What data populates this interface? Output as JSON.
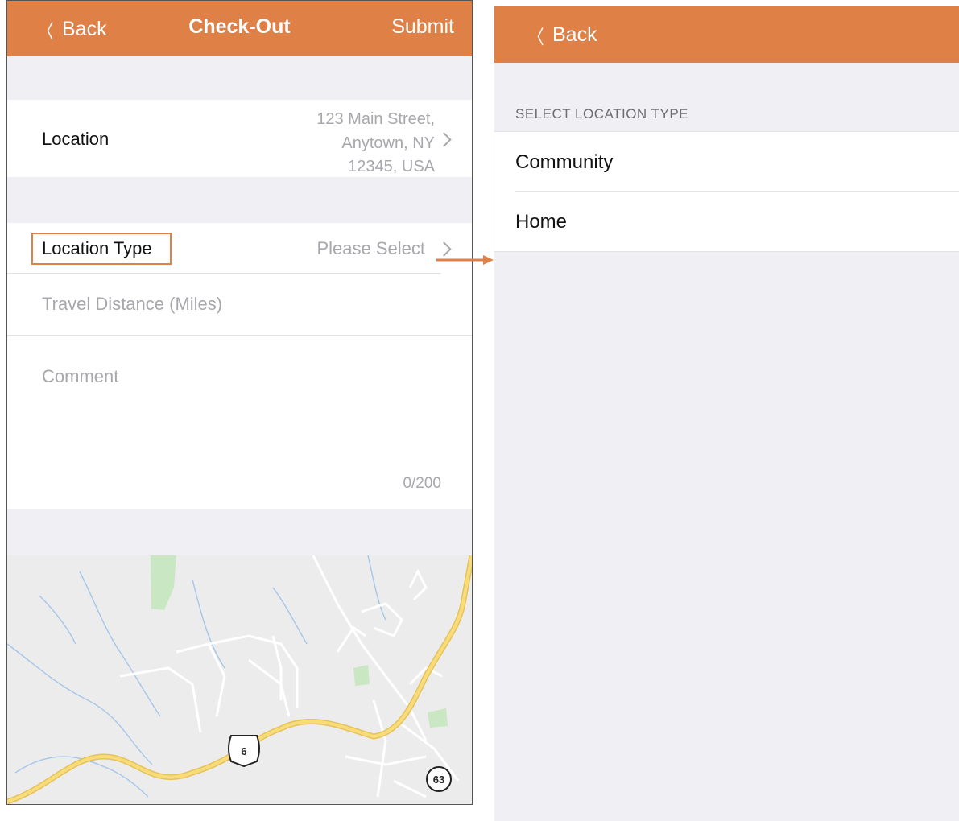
{
  "checkout": {
    "back_label": "Back",
    "title": "Check-Out",
    "submit_label": "Submit",
    "location": {
      "label": "Location",
      "address_line1": "123 Main Street,",
      "address_line2": "Anytown, NY",
      "address_line3": "12345, USA"
    },
    "location_type": {
      "label": "Location Type",
      "placeholder": "Please Select"
    },
    "travel_distance_placeholder": "Travel Distance (Miles)",
    "comment_placeholder": "Comment",
    "comment_counter": "0/200",
    "map": {
      "route_shields": [
        "6",
        "63"
      ]
    }
  },
  "location_type_picker": {
    "back_label": "Back",
    "section_header": "SELECT LOCATION TYPE",
    "options": [
      "Community",
      "Home"
    ]
  },
  "colors": {
    "accent": "#df8147",
    "background": "#efeff4",
    "muted_text": "#a7a7ac"
  }
}
